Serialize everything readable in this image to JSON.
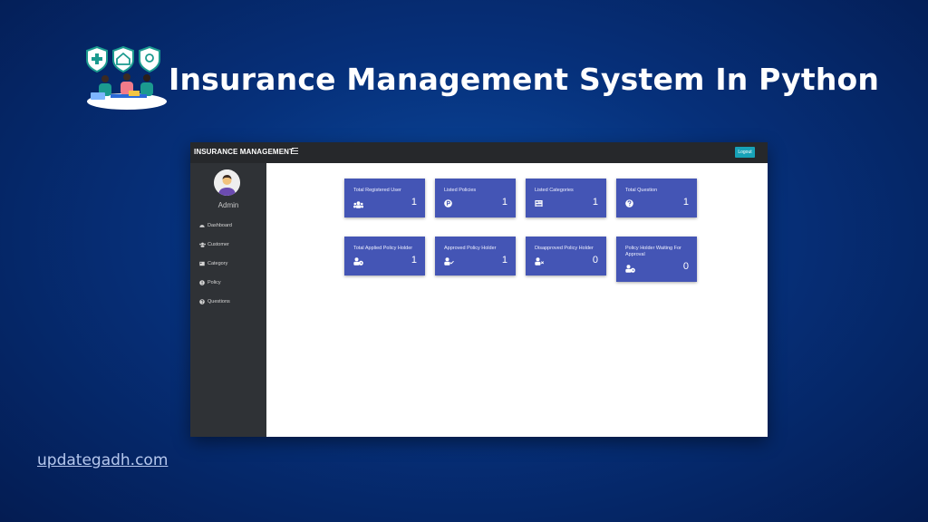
{
  "banner": {
    "title": "Insurance Management System In Python",
    "site": "updategadh.com"
  },
  "app": {
    "brand": "INSURANCE MANAGEMENT",
    "logout_label": "Logout",
    "user_name": "Admin",
    "nav": [
      {
        "label": "Dashboard",
        "icon": "dashboard-icon"
      },
      {
        "label": "Customer",
        "icon": "users-icon"
      },
      {
        "label": "Category",
        "icon": "category-icon"
      },
      {
        "label": "Policy",
        "icon": "policy-icon"
      },
      {
        "label": "Questions",
        "icon": "question-icon"
      }
    ],
    "cards": [
      {
        "label": "Total Registered User",
        "value": "1",
        "icon": "users-icon"
      },
      {
        "label": "Listed Policies",
        "value": "1",
        "icon": "policy-icon"
      },
      {
        "label": "Listed Categories",
        "value": "1",
        "icon": "category-icon"
      },
      {
        "label": "Total Question",
        "value": "1",
        "icon": "question-icon"
      },
      {
        "label": "Total Applied Policy Holder",
        "value": "1",
        "icon": "user-clock-icon"
      },
      {
        "label": "Approved Policy Holder",
        "value": "1",
        "icon": "user-check-icon"
      },
      {
        "label": "Disapproved Policy Holder",
        "value": "0",
        "icon": "user-times-icon"
      },
      {
        "label": "Policy Holder Waiting For Approval",
        "value": "0",
        "icon": "user-clock-icon"
      }
    ]
  },
  "colors": {
    "card": "#4455b5",
    "topbar": "#26282b",
    "sidebar": "#2f3236",
    "logout": "#17a2b8"
  }
}
